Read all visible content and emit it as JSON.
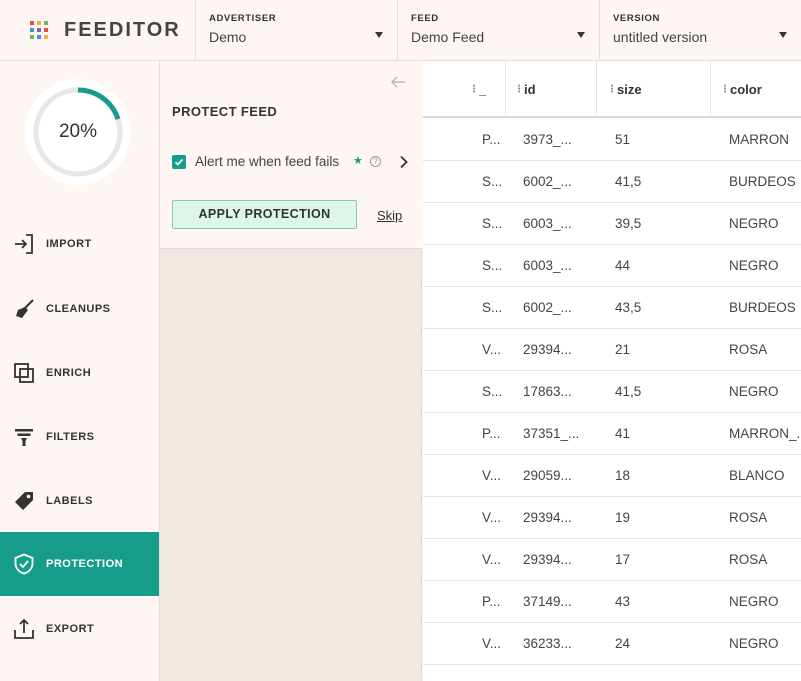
{
  "header": {
    "logo_text": "FEEDITOR",
    "advertiser": {
      "label": "ADVERTISER",
      "value": "Demo"
    },
    "feed": {
      "label": "FEED",
      "value": "Demo Feed"
    },
    "version": {
      "label": "VERSION",
      "value": "untitled version"
    }
  },
  "progress": {
    "text": "20%",
    "value": 0.2,
    "color": "#169c8a"
  },
  "sidebar": {
    "items": [
      {
        "label": "IMPORT",
        "icon": "import-icon"
      },
      {
        "label": "CLEANUPS",
        "icon": "broom-icon"
      },
      {
        "label": "ENRICH",
        "icon": "enrich-icon"
      },
      {
        "label": "FILTERS",
        "icon": "filter-icon"
      },
      {
        "label": "LABELS",
        "icon": "tag-icon"
      },
      {
        "label": "PROTECTION",
        "icon": "shield-icon",
        "active": true
      },
      {
        "label": "EXPORT",
        "icon": "export-icon"
      }
    ]
  },
  "panel": {
    "title": "PROTECT FEED",
    "alert_label": "Alert me when feed fails",
    "alert_checked": true,
    "star": "★",
    "help": "?",
    "apply_label": "APPLY PROTECTION",
    "skip_label": "Skip"
  },
  "table": {
    "columns": [
      "_",
      "id",
      "size",
      "color"
    ],
    "rows": [
      [
        "P...",
        "3973_...",
        "51",
        "MARRON"
      ],
      [
        "S...",
        "6002_...",
        "41,5",
        "BURDEOS"
      ],
      [
        "S...",
        "6003_...",
        "39,5",
        "NEGRO"
      ],
      [
        "S...",
        "6003_...",
        "44",
        "NEGRO"
      ],
      [
        "S...",
        "6002_...",
        "43,5",
        "BURDEOS"
      ],
      [
        "V...",
        "29394...",
        "21",
        "ROSA"
      ],
      [
        "S...",
        "17863...",
        "41,5",
        "NEGRO"
      ],
      [
        "P...",
        "37351_...",
        "41",
        "MARRON_..."
      ],
      [
        "V...",
        "29059...",
        "18",
        "BLANCO"
      ],
      [
        "V...",
        "29394...",
        "19",
        "ROSA"
      ],
      [
        "V...",
        "29394...",
        "17",
        "ROSA"
      ],
      [
        "P...",
        "37149...",
        "43",
        "NEGRO"
      ],
      [
        "V...",
        "36233...",
        "24",
        "NEGRO"
      ]
    ]
  },
  "colors": {
    "accent": "#169c8a",
    "apply_bg": "#dcf7e8",
    "panel_bg": "#f1e8e4",
    "page_bg": "#fdf6f2"
  }
}
